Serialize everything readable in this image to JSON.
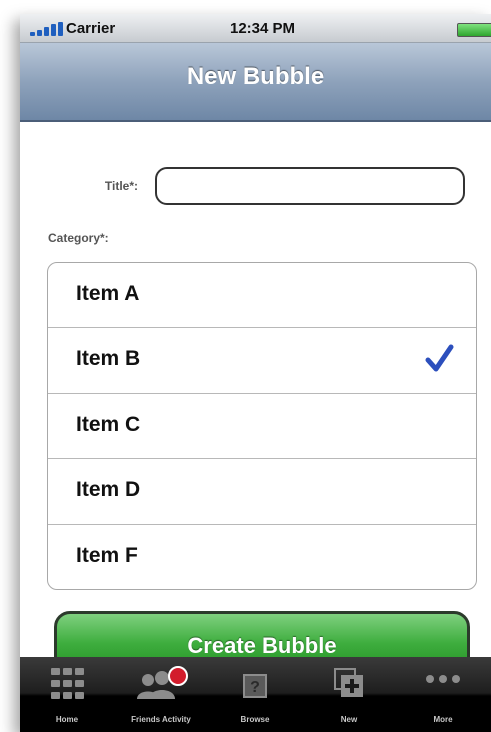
{
  "status_bar": {
    "carrier": "Carrier",
    "time": "12:34 PM"
  },
  "nav": {
    "title": "New Bubble"
  },
  "form": {
    "title_label": "Title*:",
    "title_value": "",
    "category_label": "Category*:"
  },
  "categories": [
    {
      "label": "Item A",
      "selected": false
    },
    {
      "label": "Item B",
      "selected": true
    },
    {
      "label": "Item C",
      "selected": false
    },
    {
      "label": "Item D",
      "selected": false
    },
    {
      "label": "Item F",
      "selected": false
    }
  ],
  "create_button": {
    "label": "Create Bubble"
  },
  "tab_bar": {
    "items": [
      {
        "label": "Home",
        "icon": "grid-icon"
      },
      {
        "label": "Friends Activity",
        "icon": "people-icon"
      },
      {
        "label": "Browse",
        "icon": "question-box-icon"
      },
      {
        "label": "New",
        "icon": "new-plus-icon"
      },
      {
        "label": "More",
        "icon": "more-dots-icon"
      }
    ]
  },
  "colors": {
    "accent_check": "#2c4fbd",
    "button_green": "#3fae3f",
    "badge_red": "#d21c2c"
  }
}
